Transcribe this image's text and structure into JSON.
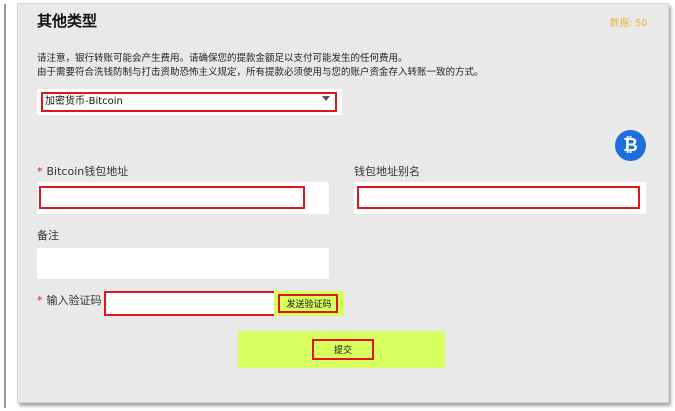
{
  "header": {
    "title": "其他类型",
    "count_label": "数据: 50"
  },
  "notices": [
    "请注意，银行转账可能会产生费用。请确保您的提款金额足以支付可能发生的任何费用。",
    "由于需要符合洗钱防制与打击资助恐怖主义规定，所有提款必须使用与您的账户资金存入转账一致的方式。"
  ],
  "type_select": {
    "selected": "加密货币-Bitcoin"
  },
  "icons": {
    "bitcoin": "bitcoin-icon",
    "bitcoin_glyph": "₿",
    "dropdown": "caret-down-icon"
  },
  "form": {
    "wallet_label": "Bitcoin钱包地址",
    "wallet_value": "",
    "alias_label": "钱包地址别名",
    "alias_value": "",
    "remark_label": "备注",
    "remark_value": "",
    "code_label": "输入验证码",
    "code_value": "",
    "send_code_label": "发送验证码",
    "submit_label": "提交",
    "required_mark": "*"
  },
  "colors": {
    "accent_green": "#d7ff5f",
    "required_red": "#e0161c",
    "bitcoin_blue": "#1e6fd9",
    "count_orange": "#e8b23a"
  }
}
